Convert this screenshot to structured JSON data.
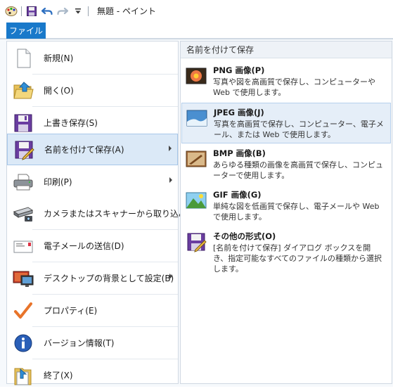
{
  "window": {
    "title": "無題 - ペイント"
  },
  "ribbon": {
    "file_tab": "ファイル"
  },
  "menu": {
    "items": [
      {
        "label": "新規(N)",
        "icon": "new-document-icon",
        "has_submenu": false
      },
      {
        "label": "開く(O)",
        "icon": "open-folder-icon",
        "has_submenu": false
      },
      {
        "label": "上書き保存(S)",
        "icon": "save-floppy-icon",
        "has_submenu": false
      },
      {
        "label": "名前を付けて保存(A)",
        "icon": "save-as-icon",
        "has_submenu": true,
        "selected": true
      },
      {
        "label": "印刷(P)",
        "icon": "printer-icon",
        "has_submenu": true
      },
      {
        "label": "カメラまたはスキャナーから取り込み(M)",
        "icon": "scanner-icon",
        "has_submenu": false
      },
      {
        "label": "電子メールの送信(D)",
        "icon": "email-icon",
        "has_submenu": false
      },
      {
        "label": "デスクトップの背景として設定(B)",
        "icon": "desktop-background-icon",
        "has_submenu": true
      },
      {
        "label": "プロパティ(E)",
        "icon": "checkmark-icon",
        "has_submenu": false
      },
      {
        "label": "バージョン情報(T)",
        "icon": "info-icon",
        "has_submenu": false
      },
      {
        "label": "終了(X)",
        "icon": "exit-icon",
        "has_submenu": false
      }
    ]
  },
  "submenu": {
    "header": "名前を付けて保存",
    "items": [
      {
        "title": "PNG 画像(P)",
        "desc": "写真や図を高画質で保存し、コンピューターや Web で使用します。",
        "icon": "png-image-icon"
      },
      {
        "title": "JPEG 画像(J)",
        "desc": "写真を高画質で保存し、コンピューター、電子メール、または Web で使用します。",
        "icon": "jpeg-image-icon",
        "selected": true
      },
      {
        "title": "BMP 画像(B)",
        "desc": "あらゆる種類の画像を高画質で保存し、コンピューターで使用します。",
        "icon": "bmp-image-icon"
      },
      {
        "title": "GIF 画像(G)",
        "desc": "単純な図を低画質で保存し、電子メールや Web で使用します。",
        "icon": "gif-image-icon"
      },
      {
        "title": "その他の形式(O)",
        "desc": "[名前を付けて保存] ダイアログ ボックスを開き、指定可能なすべてのファイルの種類から選択します。",
        "icon": "other-formats-icon"
      }
    ]
  },
  "colors": {
    "accent": "#1979ca",
    "selection": "#dbe9f7"
  }
}
